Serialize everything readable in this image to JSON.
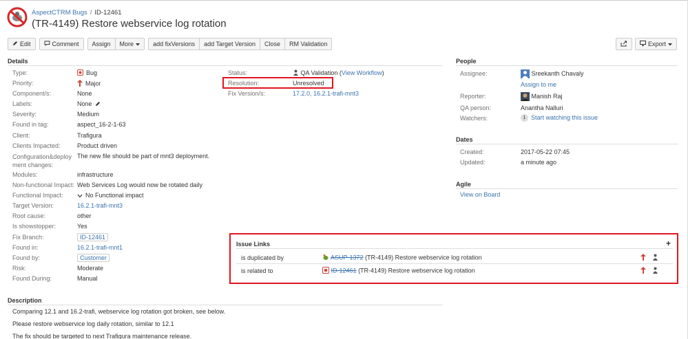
{
  "header": {
    "project": "AspectCTRM Bugs",
    "separator": "/",
    "issue_key": "ID-12461",
    "title": "(TR-4149) Restore webservice log rotation"
  },
  "toolbar": {
    "edit": "Edit",
    "comment": "Comment",
    "assign": "Assign",
    "more": "More",
    "add_fix_versions": "add fixVersions",
    "add_target_version": "add Target Version",
    "close": "Close",
    "rm_validation": "RM Validation",
    "export": "Export"
  },
  "details": {
    "heading": "Details",
    "fields": [
      {
        "label": "Type:",
        "value": "Bug"
      },
      {
        "label": "Priority:",
        "value": "Major"
      },
      {
        "label": "Component/s:",
        "value": "None"
      },
      {
        "label": "Labels:",
        "value": "None"
      },
      {
        "label": "Severity:",
        "value": "Medium"
      },
      {
        "label": "Found in tag:",
        "value": "aspect_16-2-1-63"
      },
      {
        "label": "Client:",
        "value": "Trafigura"
      },
      {
        "label": "Clients Impacted:",
        "value": "Product driven"
      },
      {
        "label": "Configuration&deploy",
        "label2": "ment changes:",
        "value": "The new file should be part of mnt3 deployment."
      },
      {
        "label": "Modules:",
        "value": "infrastructure"
      },
      {
        "label": "Non-functional Impact:",
        "value": "Web Services Log would now be rotated daily"
      },
      {
        "label": "Functional Impact:",
        "value": "No Functional impact"
      },
      {
        "label": "Target Version:",
        "value": "16.2.1-trafi-mnt3"
      },
      {
        "label": "Root cause:",
        "value": "other"
      },
      {
        "label": "Is showstopper:",
        "value": "Yes"
      },
      {
        "label": "Fix Branch:",
        "value": "ID-12461"
      },
      {
        "label": "Found in:",
        "value": "16.2.1-trafi-mnt1"
      },
      {
        "label": "Found by:",
        "value": "Customer"
      },
      {
        "label": "Risk:",
        "value": "Moderate"
      },
      {
        "label": "Found During:",
        "value": "Manual"
      }
    ],
    "status_label": "Status:",
    "status_value": "QA Validation",
    "status_paren_open": "(",
    "view_workflow": "View Workflow",
    "status_paren_close": ")",
    "resolution_label": "Resolution:",
    "resolution_value": "Unresolved",
    "fix_version_label": "Fix Version/s:",
    "fix_version_value": "17.2.0, 16.2.1-trafi-mnt3"
  },
  "people": {
    "heading": "People",
    "assignee_label": "Assignee:",
    "assignee": "Sreekanth Chavaly",
    "assign_to_me": "Assign to me",
    "reporter_label": "Reporter:",
    "reporter": "Manish Raj",
    "qa_label": "QA person:",
    "qa": "Anantha Nalluri",
    "watchers_label": "Watchers:",
    "watchers_count": "1",
    "watch_link": "Start watching this issue"
  },
  "dates": {
    "heading": "Dates",
    "created_label": "Created:",
    "created": "2017-05-22 07:45",
    "updated_label": "Updated:",
    "updated": "a minute ago"
  },
  "agile": {
    "heading": "Agile",
    "view_on_board": "View on Board"
  },
  "issue_links": {
    "heading": "Issue Links",
    "add": "+",
    "links": [
      {
        "relation": "is duplicated by",
        "key": "ASUP-1372",
        "summary": "(TR-4149) Restore webservice log rotation"
      },
      {
        "relation": "is related to",
        "key": "ID-12461",
        "summary": "(TR-4149) Restore webservice log rotation"
      }
    ]
  },
  "description": {
    "heading": "Description",
    "lines": [
      "Comparing 12.1 and 16.2-trafi, webservice log rotation got broken, see below.",
      "Please restore webservice log daily rotation, similar to 12.1",
      "The fix should be targeted to next Trafigura maintenance release."
    ]
  },
  "colors": {
    "link": "#3b73af",
    "highlight": "#e0141e",
    "priority": "#d04437"
  }
}
